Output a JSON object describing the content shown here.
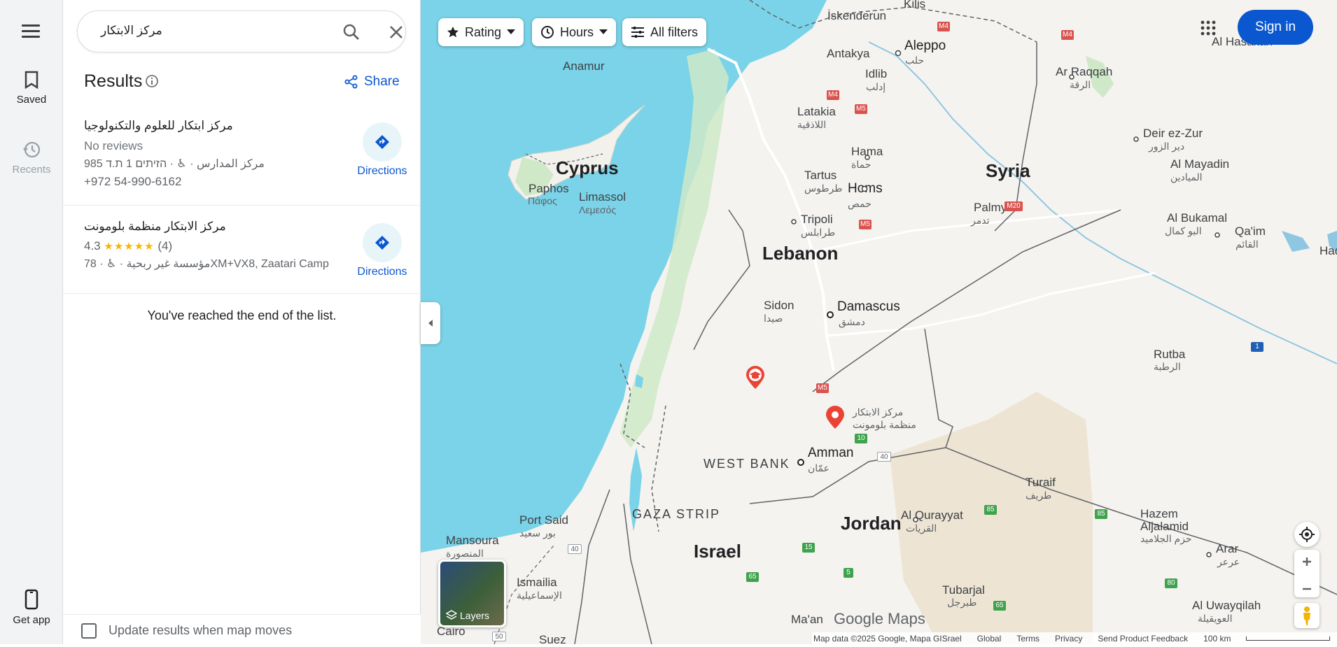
{
  "rail": {
    "saved_label": "Saved",
    "recents_label": "Recents",
    "get_app_label": "Get app"
  },
  "search": {
    "query": "مركز الابتكار"
  },
  "results": {
    "title": "Results",
    "share_label": "Share",
    "items": [
      {
        "name": "مركز ابتكار للعلوم والتكنولوجيا",
        "rating_text": "No reviews",
        "details": "مركز المدارس · ♿ · הזיתים 1 ת.ד 985",
        "phone": "+972 54-990-6162",
        "directions_label": "Directions"
      },
      {
        "name": "مركز الابتكار منظمة بلومونت",
        "rating": "4.3",
        "stars": "★★★★★",
        "review_count": "(4)",
        "details": "مؤسسة غير ربحية · ♿ · 78XM+VX8, Zaatari Camp",
        "directions_label": "Directions"
      }
    ],
    "end_text": "You've reached the end of the list."
  },
  "update_checkbox": {
    "label": "Update results when map moves",
    "checked": false
  },
  "filters": {
    "rating": "Rating",
    "hours": "Hours",
    "all_filters": "All filters"
  },
  "header": {
    "sign_in": "Sign in"
  },
  "map": {
    "layers_label": "Layers",
    "logo": "Google Maps",
    "labels": {
      "cyprus": "Cyprus",
      "syria": "Syria",
      "lebanon": "Lebanon",
      "jordan": "Jordan",
      "israel": "Israel",
      "west_bank": "WEST BANK",
      "gaza_strip": "GAZA STRIP",
      "aleppo": "Aleppo",
      "aleppo_ar": "حلب",
      "homs": "Homs",
      "homs_ar": "حمص",
      "damascus": "Damascus",
      "damascus_ar": "دمشق",
      "amman": "Amman",
      "amman_ar": "عمّان",
      "hama": "Hama",
      "hama_ar": "حماة",
      "latakia": "Latakia",
      "latakia_ar": "اللاذقية",
      "tartus": "Tartus",
      "tartus_ar": "طرطوس",
      "tripoli": "Tripoli",
      "tripoli_ar": "طرابلس",
      "sidon": "Sidon",
      "sidon_ar": "صيدا",
      "idlib": "Idlib",
      "idlib_ar": "إدلب",
      "antakya": "Antakya",
      "iskenderun": "İskenderun",
      "kilis": "Kilis",
      "anamur": "Anamur",
      "paphos": "Paphos",
      "paphos_gr": "Πάφος",
      "limassol": "Limassol",
      "limassol_gr": "Λεμεσός",
      "ar_raqqah": "Ar Raqqah",
      "ar_raqqah_ar": "الرقة",
      "al_hasakah": "Al Hasakah",
      "deir_ez_zur": "Deir ez-Zur",
      "deir_ez_zur_ar": "دير الزور",
      "al_mayadin": "Al Mayadin",
      "al_mayadin_ar": "الميادين",
      "palmyra": "Palmyra",
      "palmyra_ar": "تدمر",
      "al_bukamal": "Al Bukamal",
      "al_bukamal_ar": "البو كمال",
      "qaim": "Qa'im",
      "qaim_ar": "القائم",
      "rutba": "Rutba",
      "rutba_ar": "الرطبة",
      "turaif": "Turaif",
      "turaif_ar": "طريف",
      "al_qurayyat": "Al Qurayyat",
      "al_qurayyat_ar": "القريات",
      "hazem": "Hazem",
      "hazem2": "Aljalamid",
      "hazem_ar": "حزم الجلاميد",
      "arar": "Arar",
      "arar_ar": "عرعر",
      "tubarjal": "Tubarjal",
      "tubarjal_ar": "طبرجل",
      "al_uwayqilah": "Al Uwayqilah",
      "al_uwayqilah_ar": "العويقيلة",
      "port_said": "Port Said",
      "port_said_ar": "بور سعيد",
      "mansoura": "Mansoura",
      "mansoura_ar": "المنصورة",
      "ismailia": "Ismailia",
      "ismailia_ar": "الإسماعيلية",
      "cairo": "Cairo",
      "suez": "Suez",
      "maan": "Ma'an",
      "had": "Had",
      "pin_label_1": "مركز الابتكار",
      "pin_label_2": "منظمة بلومونت"
    },
    "highways": [
      {
        "label": "M4",
        "color": "red"
      },
      {
        "label": "M4",
        "color": "red"
      },
      {
        "label": "M4",
        "color": "red"
      },
      {
        "label": "M5",
        "color": "red"
      },
      {
        "label": "M5",
        "color": "red"
      },
      {
        "label": "M5",
        "color": "red"
      },
      {
        "label": "M20",
        "color": "red"
      },
      {
        "label": "10",
        "color": "green"
      },
      {
        "label": "40",
        "color": "white"
      },
      {
        "label": "40",
        "color": "white"
      },
      {
        "label": "15",
        "color": "green"
      },
      {
        "label": "65",
        "color": "green"
      },
      {
        "label": "5",
        "color": "green"
      },
      {
        "label": "85",
        "color": "green"
      },
      {
        "label": "85",
        "color": "green"
      },
      {
        "label": "80",
        "color": "green"
      },
      {
        "label": "65",
        "color": "green"
      },
      {
        "label": "1",
        "color": "blue"
      },
      {
        "label": "50",
        "color": "white"
      }
    ],
    "footer": {
      "map_data": "Map data ©2025 Google, Mapa GISrael",
      "global": "Global",
      "terms": "Terms",
      "privacy": "Privacy",
      "feedback": "Send Product Feedback",
      "scale": "100 km"
    }
  },
  "colors": {
    "accent": "#0b57d0",
    "water": "#7ad3e8",
    "land": "#f5f3ef",
    "pin": "#ea4335"
  }
}
